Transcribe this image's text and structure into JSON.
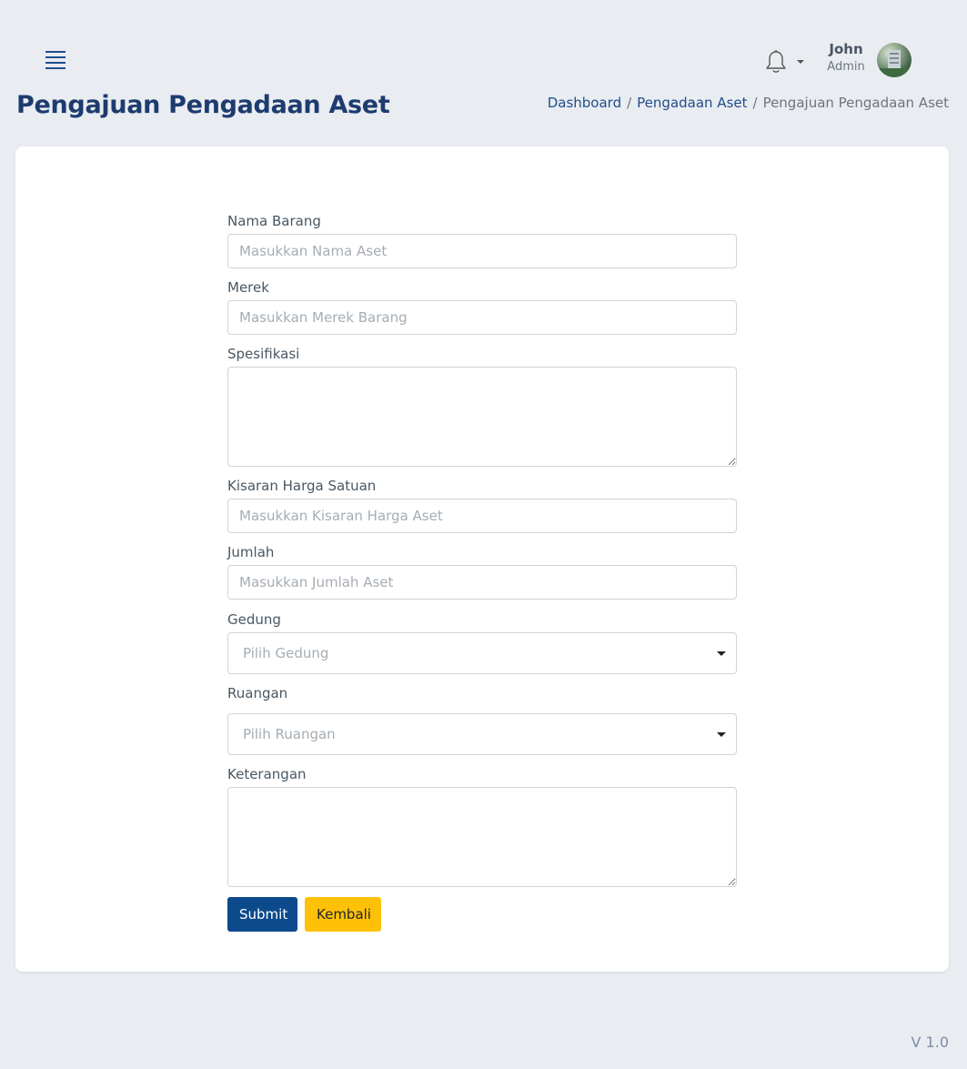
{
  "header": {
    "menu_icon": "hamburger-icon",
    "notification_icon": "bell-icon",
    "user": {
      "name": "John",
      "role": "Admin"
    }
  },
  "page": {
    "title": "Pengajuan Pengadaan Aset",
    "breadcrumb": [
      {
        "label": "Dashboard"
      },
      {
        "label": "Pengadaan Aset"
      },
      {
        "label": "Pengajuan Pengadaan Aset"
      }
    ],
    "separator": "/"
  },
  "form": {
    "nama_barang": {
      "label": "Nama Barang",
      "placeholder": "Masukkan Nama Aset",
      "value": ""
    },
    "merek": {
      "label": "Merek",
      "placeholder": "Masukkan Merek Barang",
      "value": ""
    },
    "spesifikasi": {
      "label": "Spesifikasi",
      "value": ""
    },
    "kisaran_harga": {
      "label": "Kisaran Harga Satuan",
      "placeholder": "Masukkan Kisaran Harga Aset",
      "value": ""
    },
    "jumlah": {
      "label": "Jumlah",
      "placeholder": "Masukkan Jumlah Aset",
      "value": ""
    },
    "gedung": {
      "label": "Gedung",
      "placeholder": "Pilih Gedung"
    },
    "ruangan": {
      "label": "Ruangan",
      "placeholder": "Pilih Ruangan"
    },
    "keterangan": {
      "label": "Keterangan",
      "value": ""
    },
    "submit_label": "Submit",
    "back_label": "Kembali"
  },
  "footer": {
    "version": "V 1.0"
  },
  "colors": {
    "primary": "#0c4a8c",
    "warning": "#ffc107",
    "title": "#1d3b6e",
    "background": "#e9ecf1"
  }
}
